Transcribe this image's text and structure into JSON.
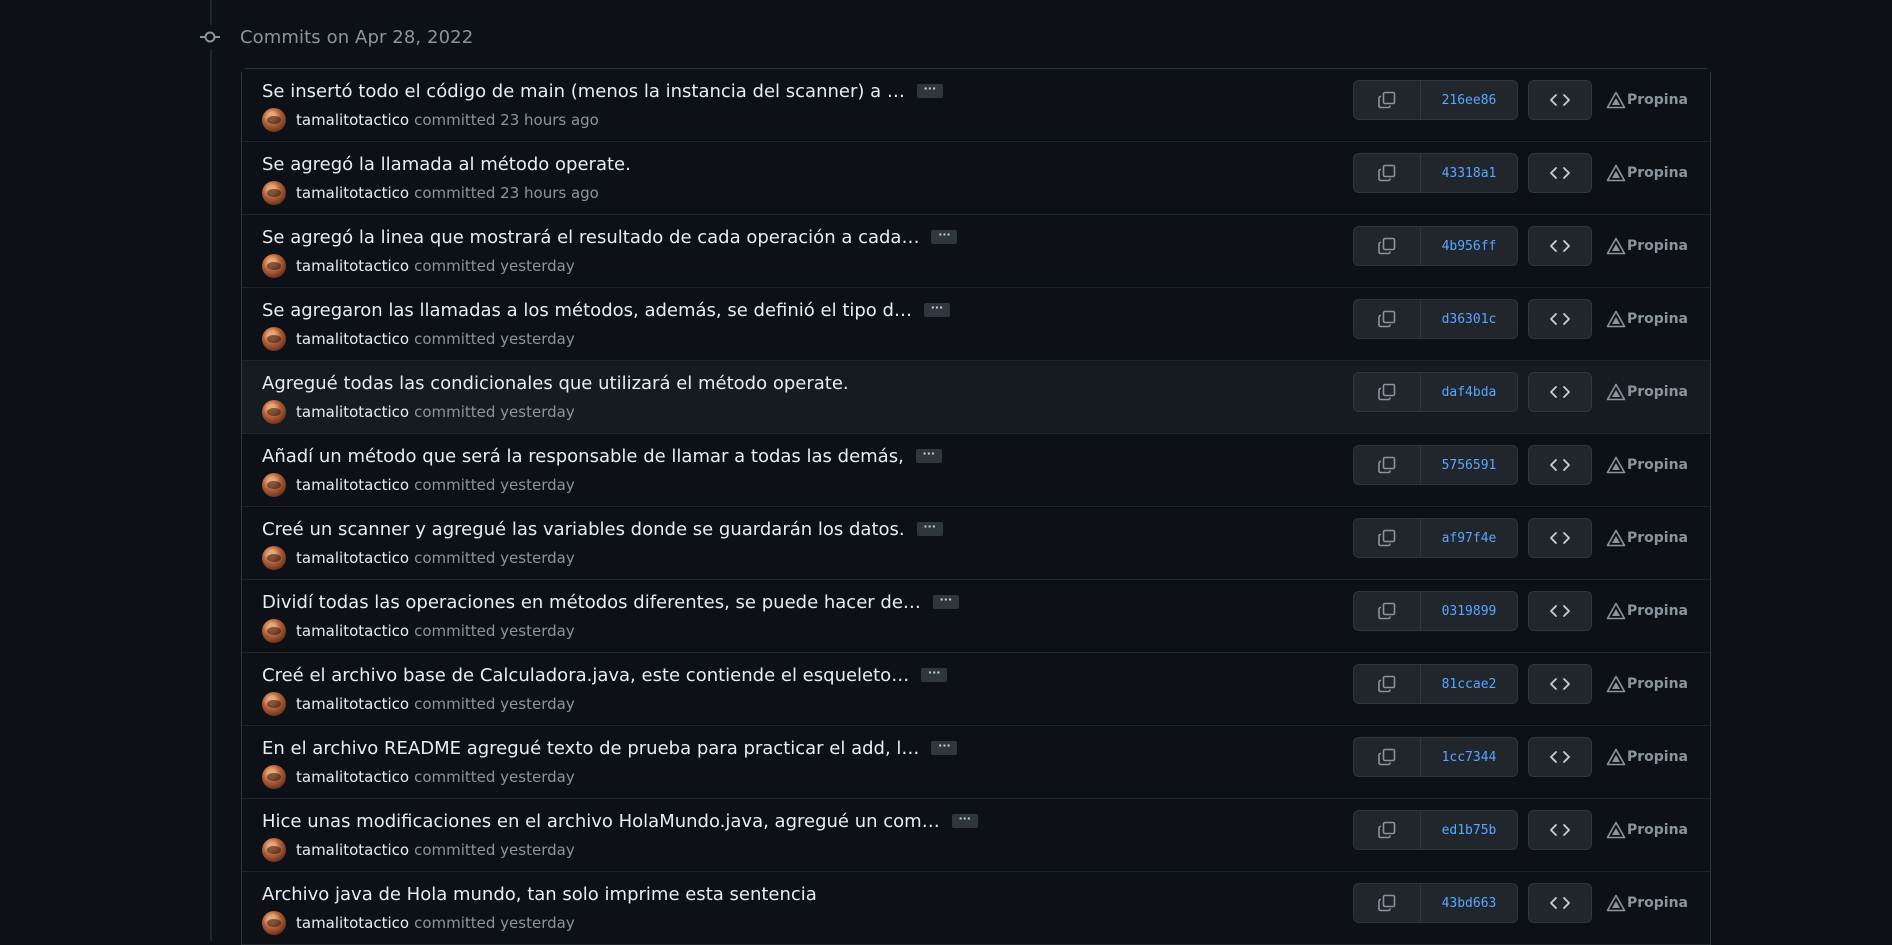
{
  "timeline": {
    "title": "Commits on Apr 28, 2022"
  },
  "colors": {
    "background": "#0d1117",
    "border": "#30363d",
    "link": "#58a6ff",
    "muted": "#8b949e",
    "text": "#e6edf3"
  },
  "icons": {
    "timeline": "git-commit-icon",
    "copy": "copy-icon",
    "browse": "code-icon",
    "status": "triangle-deployment-icon",
    "ellipsis": "ellipsis-icon"
  },
  "commits": [
    {
      "message": "Se insertó todo el código de main (menos la instancia del scanner) a …",
      "has_more": true,
      "author": "tamalitotactico",
      "time": "committed 23 hours ago",
      "sha": "216ee86",
      "status": "Propina",
      "hover": false
    },
    {
      "message": "Se agregó la llamada al método operate.",
      "has_more": false,
      "author": "tamalitotactico",
      "time": "committed 23 hours ago",
      "sha": "43318a1",
      "status": "Propina",
      "hover": false
    },
    {
      "message": "Se agregó la linea que mostrará el resultado de cada operación a cada…",
      "has_more": true,
      "author": "tamalitotactico",
      "time": "committed yesterday",
      "sha": "4b956ff",
      "status": "Propina",
      "hover": false
    },
    {
      "message": "Se agregaron las llamadas a los métodos, además, se definió el tipo d…",
      "has_more": true,
      "author": "tamalitotactico",
      "time": "committed yesterday",
      "sha": "d36301c",
      "status": "Propina",
      "hover": false
    },
    {
      "message": "Agregué todas las condicionales que utilizará el método operate.",
      "has_more": false,
      "author": "tamalitotactico",
      "time": "committed yesterday",
      "sha": "daf4bda",
      "status": "Propina",
      "hover": true
    },
    {
      "message": "Añadí un método que será la responsable de llamar a todas las demás,",
      "has_more": true,
      "author": "tamalitotactico",
      "time": "committed yesterday",
      "sha": "5756591",
      "status": "Propina",
      "hover": false
    },
    {
      "message": "Creé un scanner y agregué las variables donde se guardarán los datos.",
      "has_more": true,
      "author": "tamalitotactico",
      "time": "committed yesterday",
      "sha": "af97f4e",
      "status": "Propina",
      "hover": false
    },
    {
      "message": "Dividí todas las operaciones en métodos diferentes, se puede hacer de…",
      "has_more": true,
      "author": "tamalitotactico",
      "time": "committed yesterday",
      "sha": "0319899",
      "status": "Propina",
      "hover": false
    },
    {
      "message": "Creé el archivo base de Calculadora.java, este contiende el esqueleto…",
      "has_more": true,
      "author": "tamalitotactico",
      "time": "committed yesterday",
      "sha": "81ccae2",
      "status": "Propina",
      "hover": false
    },
    {
      "message": "En el archivo README agregué texto de prueba para practicar el add, l…",
      "has_more": true,
      "author": "tamalitotactico",
      "time": "committed yesterday",
      "sha": "1cc7344",
      "status": "Propina",
      "hover": false
    },
    {
      "message": "Hice unas modificaciones en el archivo HolaMundo.java, agregué un com…",
      "has_more": true,
      "author": "tamalitotactico",
      "time": "committed yesterday",
      "sha": "ed1b75b",
      "status": "Propina",
      "hover": false
    },
    {
      "message": "Archivo java de Hola mundo, tan solo imprime esta sentencia",
      "has_more": false,
      "author": "tamalitotactico",
      "time": "committed yesterday",
      "sha": "43bd663",
      "status": "Propina",
      "hover": false
    }
  ]
}
